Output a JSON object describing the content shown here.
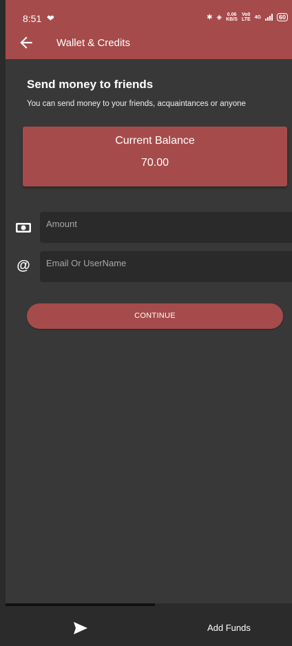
{
  "status_bar": {
    "time": "8:51",
    "net_speed_top": "0.06",
    "net_speed_bottom": "KB/S",
    "volte_top": "Vo0",
    "volte_bottom": "LTE",
    "network_type": "4G",
    "battery": "60"
  },
  "app_bar": {
    "back_icon": "arrow-left-icon",
    "title": "Wallet & Credits"
  },
  "section": {
    "title": "Send money to friends",
    "subtitle": "You can send money to your friends, acquaintances or anyone"
  },
  "balance_card": {
    "label": "Current Balance",
    "value": "70.00"
  },
  "form": {
    "amount_placeholder": "Amount",
    "amount_icon": "money-icon",
    "email_placeholder": "Email Or UserName",
    "email_icon": "at-icon",
    "continue_label": "CONTINUE"
  },
  "bottom_nav": {
    "send_icon": "send-icon",
    "add_funds_label": "Add Funds"
  },
  "colors": {
    "accent": "#a64b4b",
    "background": "#383838",
    "field": "#2a2a2a"
  }
}
